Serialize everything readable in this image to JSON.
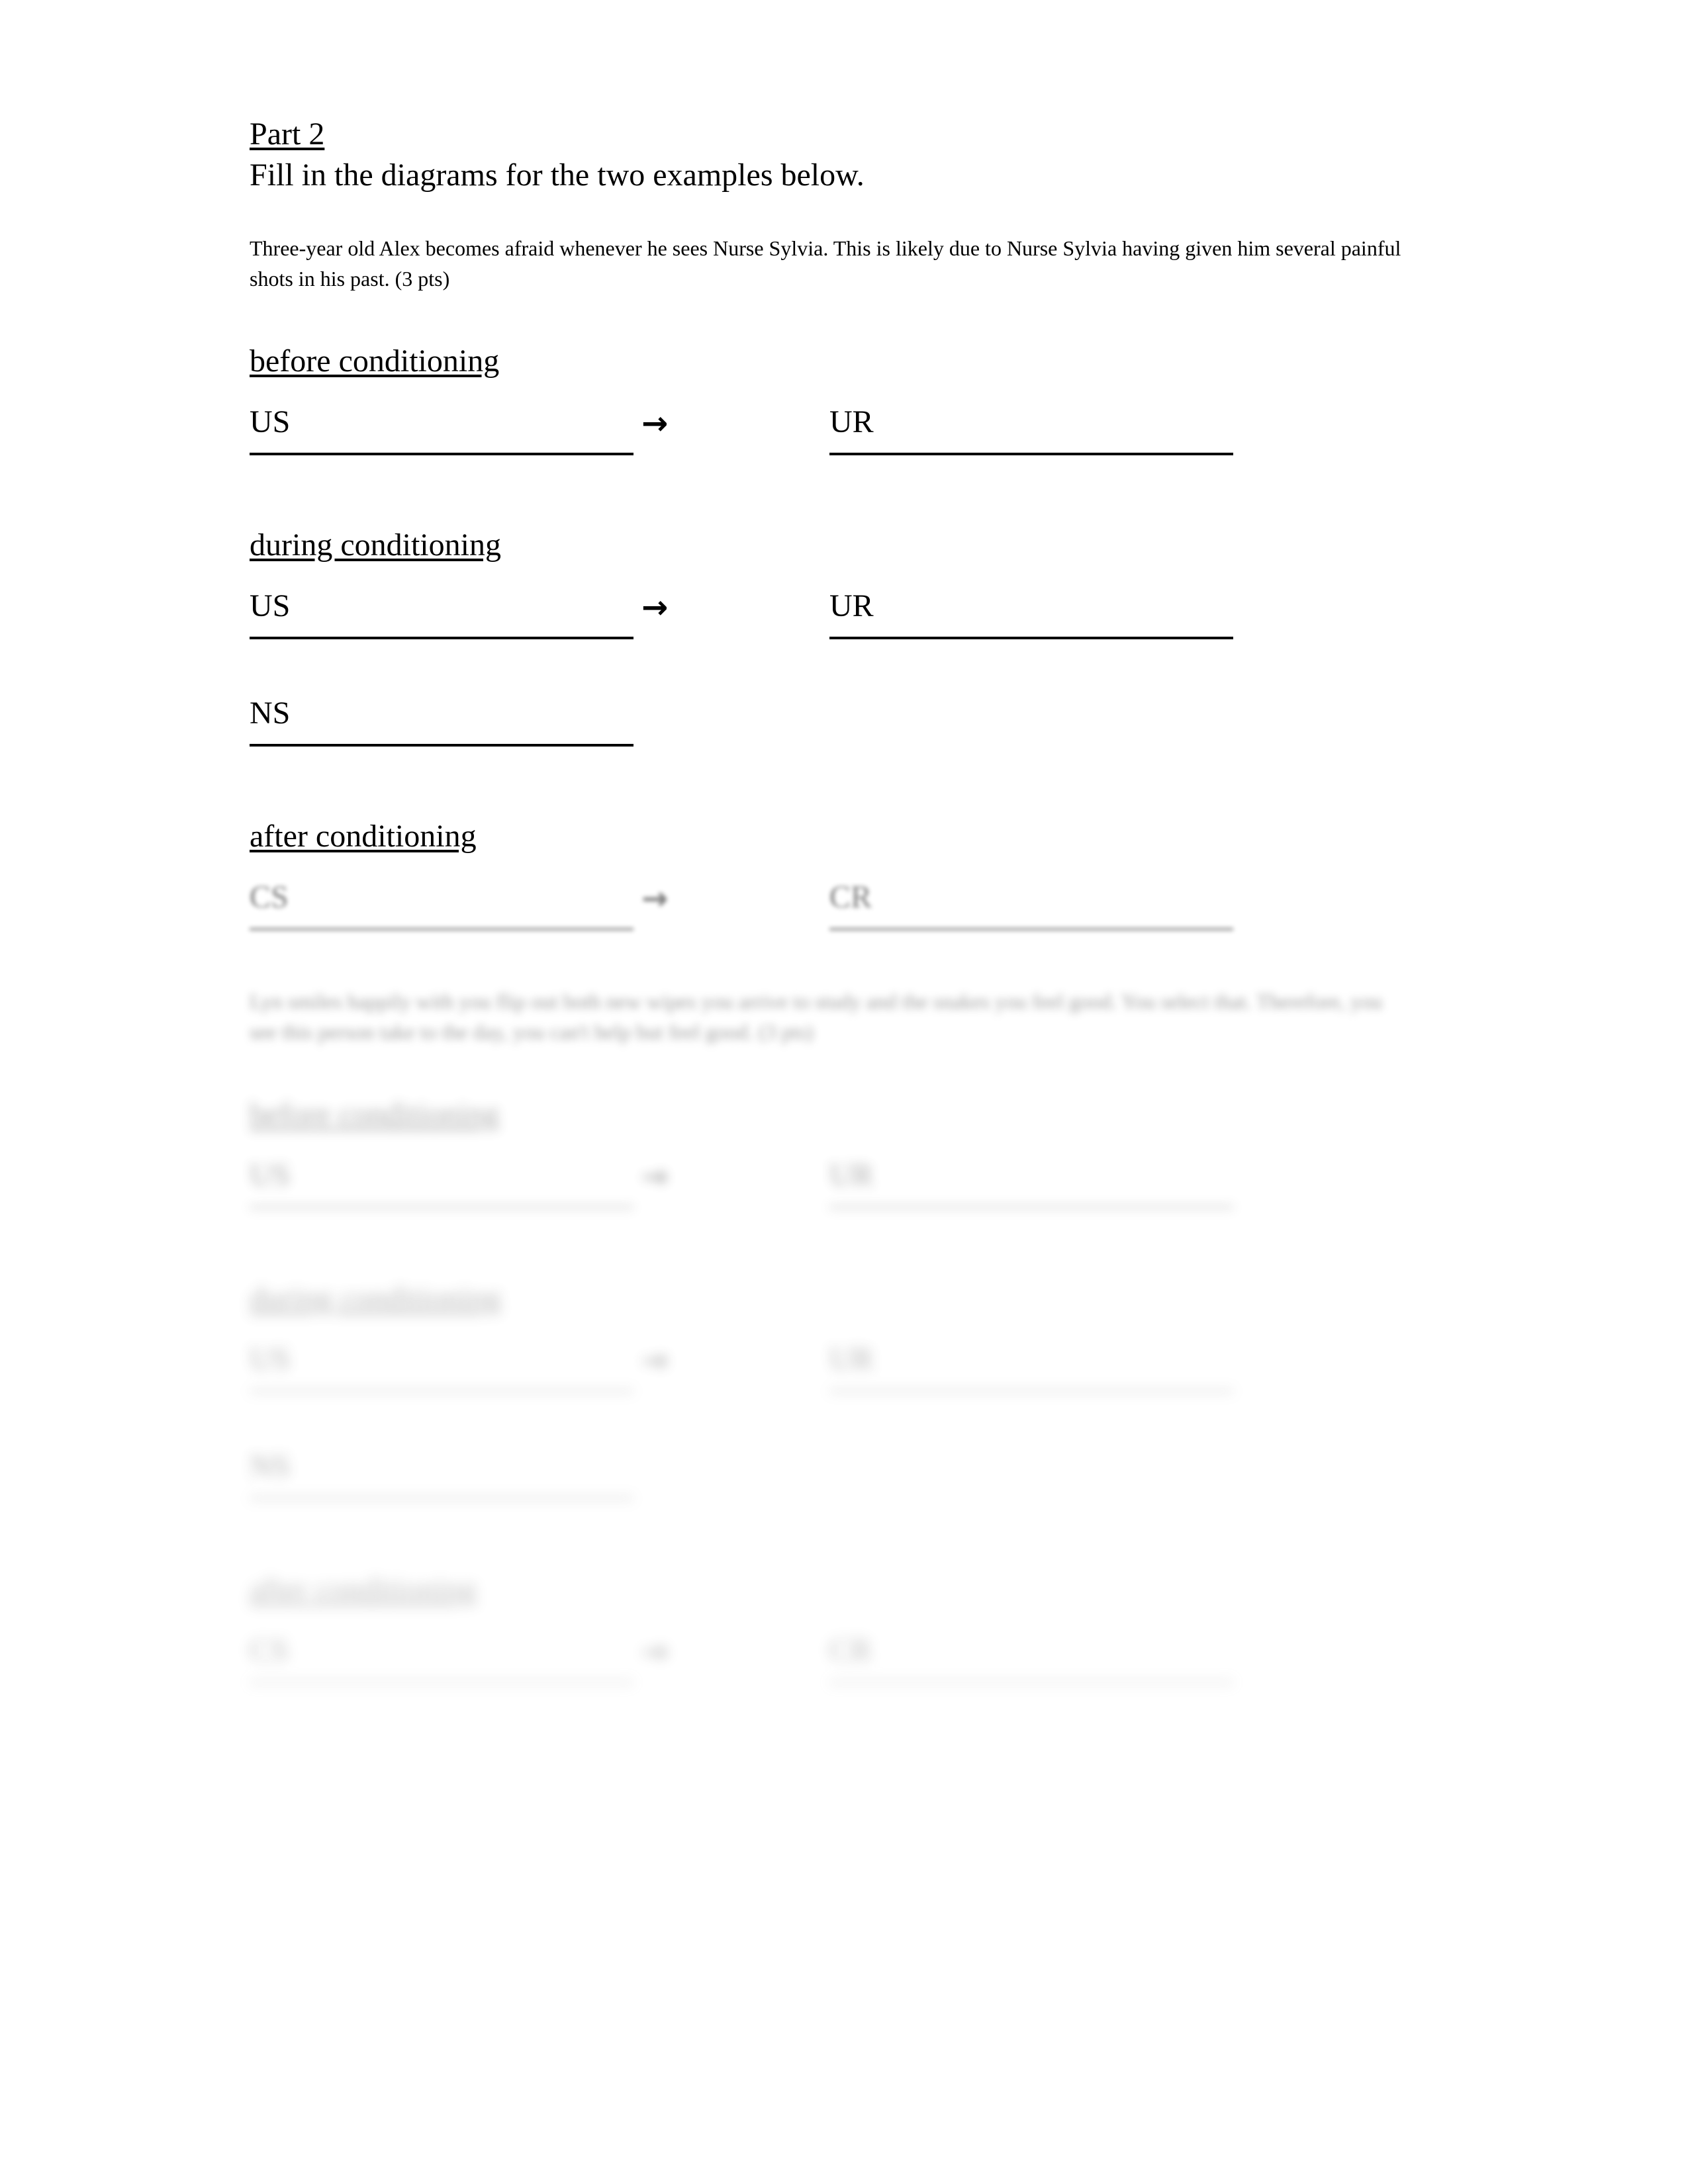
{
  "document": {
    "part_label": "Part 2",
    "instruction": "Fill in the diagrams for the two examples below."
  },
  "example_1": {
    "prompt": "Three-year old Alex becomes afraid whenever he sees Nurse Sylvia.  This is likely due to Nurse Sylvia having given him several painful shots in his past. (3 pts)",
    "arrow": "→",
    "sections": [
      {
        "heading": "before conditioning",
        "rows": [
          {
            "left": "US",
            "right": "UR",
            "has_arrow": true
          }
        ]
      },
      {
        "heading": "during conditioning",
        "rows": [
          {
            "left": "US",
            "right": "UR",
            "has_arrow": true
          },
          {
            "left": "NS",
            "right": "",
            "has_arrow": false
          }
        ]
      },
      {
        "heading": "after conditioning",
        "rows": [
          {
            "left": "CS",
            "right": "CR",
            "has_arrow": true
          }
        ]
      }
    ]
  },
  "example_2": {
    "prompt": "Lyn smiles happily with you flip out both new wipes you arrive to study and the snakes you feel good. You select that. Therefore, you see this person take to the day, you can't help but feel good. (3 pts)",
    "arrow": "→",
    "sections": [
      {
        "heading": "before conditioning",
        "rows": [
          {
            "left": "US",
            "right": "UR",
            "has_arrow": true
          }
        ]
      },
      {
        "heading": "during conditioning",
        "rows": [
          {
            "left": "US",
            "right": "UR",
            "has_arrow": true
          },
          {
            "left": "NS",
            "right": "",
            "has_arrow": false
          }
        ]
      },
      {
        "heading": "after conditioning",
        "rows": [
          {
            "left": "CS",
            "right": "CR",
            "has_arrow": true
          }
        ]
      }
    ]
  },
  "colors": {
    "page_background": "#ffffff",
    "text": "#000000",
    "rule": "#000000",
    "blurred_text": "#4a4a4a"
  }
}
